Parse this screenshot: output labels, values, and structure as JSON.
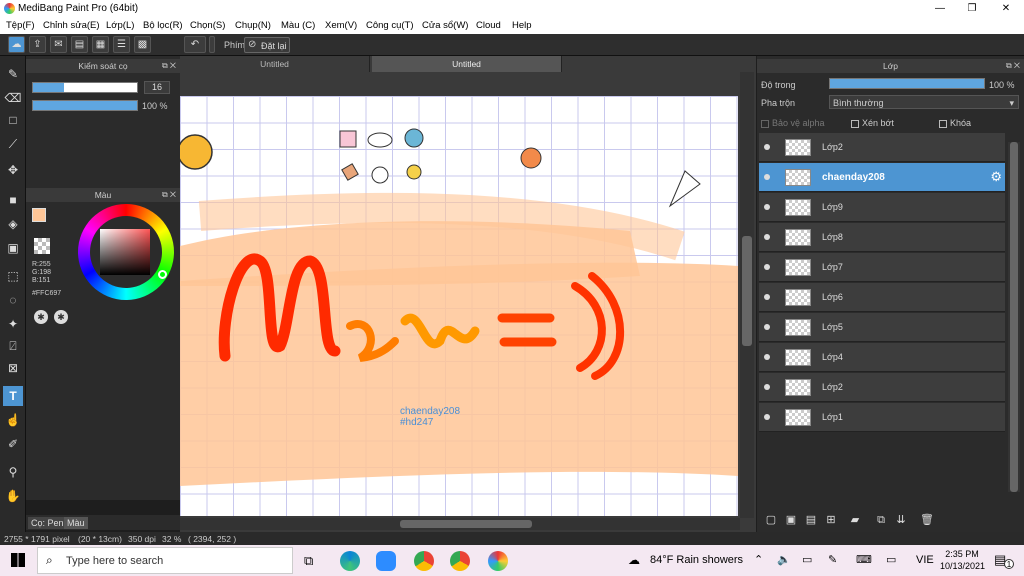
{
  "window": {
    "title": "MediBang Paint Pro (64bit)"
  },
  "menu": [
    "Tệp(F)",
    "Chỉnh sửa(E)",
    "Lớp(L)",
    "Bộ lọc(R)",
    "Chọn(S)",
    "Chụp(N)",
    "Màu (C)",
    "Xem(V)",
    "Công cụ(T)",
    "Cửa sổ(W)",
    "Cloud",
    "Help"
  ],
  "toolbar": {
    "key_label": "Phím",
    "reset_label": "Đặt lại"
  },
  "brush_panel": {
    "title": "Kiểm soát cọ",
    "size_value": "16",
    "opacity_value": "100 %",
    "size_level": 0.3,
    "opacity_level": 1.0
  },
  "color_panel": {
    "title": "Màu",
    "rgb_r": "R:255",
    "rgb_g": "G:198",
    "rgb_b": "B:151",
    "hex": "#FFC697",
    "primary_color": "#FFC697"
  },
  "left_tabs": {
    "pen": "Cọ: Pen",
    "color": "Màu"
  },
  "tabs": [
    "Untitled",
    "Untitled"
  ],
  "canvas": {
    "text_line1": "chaenday208",
    "text_line2": "#hd247",
    "stroke_color": "#FFC697"
  },
  "layers_panel": {
    "title": "Lớp",
    "opacity_label": "Độ trong",
    "opacity_value": "100 %",
    "opacity_level": 1.0,
    "blend_label": "Pha trộn",
    "blend_value": "Bình thường",
    "protect_alpha": "Bảo vệ alpha",
    "clipping": "Xén bớt",
    "lock": "Khóa",
    "layers": [
      "Lớp2",
      "chaenday208",
      "Lớp9",
      "Lớp8",
      "Lớp7",
      "Lớp6",
      "Lớp5",
      "Lớp4",
      "Lớp2",
      "Lớp1"
    ],
    "selected_index": 1
  },
  "status": {
    "size": "2755 * 1791 pixel",
    "cm": "(20 * 13cm)",
    "dpi": "350 dpi",
    "zoom": "32 %",
    "coords": "( 2394, 252 )"
  },
  "taskbar": {
    "search_placeholder": "Type here to search",
    "weather": "84°F  Rain showers",
    "lang": "VIE",
    "time": "2:35 PM",
    "date": "10/13/2021",
    "notif_count": "1"
  }
}
